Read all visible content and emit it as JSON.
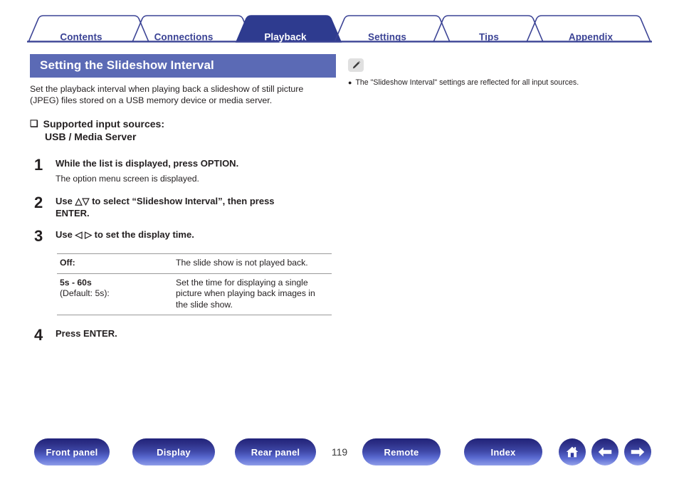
{
  "tabs": [
    {
      "label": "Contents",
      "active": false,
      "name": "tab-contents"
    },
    {
      "label": "Connections",
      "active": false,
      "name": "tab-connections"
    },
    {
      "label": "Playback",
      "active": true,
      "name": "tab-playback"
    },
    {
      "label": "Settings",
      "active": false,
      "name": "tab-settings"
    },
    {
      "label": "Tips",
      "active": false,
      "name": "tab-tips"
    },
    {
      "label": "Appendix",
      "active": false,
      "name": "tab-appendix"
    }
  ],
  "main": {
    "title": "Setting the Slideshow Interval",
    "intro": "Set the playback interval when playing back a slideshow of still picture (JPEG) files stored on a USB memory device or media server.",
    "sources_bullet": "❑",
    "sources_heading": "Supported input sources:",
    "sources_value": "USB / Media Server",
    "steps": [
      {
        "number": "1",
        "title": "While the list is displayed, press OPTION.",
        "sub": "The option menu screen is displayed."
      },
      {
        "number": "2",
        "title": "Use △▽ to select “Slideshow Interval”, then press ENTER.",
        "sub": ""
      },
      {
        "number": "3",
        "title": "Use ◁ ▷ to set the display time.",
        "sub": ""
      },
      {
        "number": "4",
        "title": "Press ENTER.",
        "sub": ""
      }
    ],
    "table": {
      "rows": [
        {
          "option": "Off:",
          "option_sub": "",
          "description": "The slide show is not played back."
        },
        {
          "option": "5s - 60s",
          "option_sub": "(Default: 5s):",
          "description": "Set the time for displaying a single picture when playing back images in the slide show."
        }
      ]
    }
  },
  "note": {
    "icon": "pencil-icon",
    "bullet": "●",
    "items": [
      "The \"Slideshow Interval\" settings are reflected for all input sources."
    ]
  },
  "bottom_nav": {
    "buttons": [
      {
        "label": "Front panel",
        "name": "front-panel-button"
      },
      {
        "label": "Display",
        "name": "display-button"
      },
      {
        "label": "Rear panel",
        "name": "rear-panel-button"
      },
      {
        "label": "Remote",
        "name": "remote-button"
      },
      {
        "label": "Index",
        "name": "index-button"
      }
    ],
    "page_number": "119",
    "icons": [
      {
        "name": "home-icon"
      },
      {
        "name": "back-arrow-icon"
      },
      {
        "name": "forward-arrow-icon"
      }
    ]
  },
  "colors": {
    "tab_navy": "#3b4395",
    "tab_active_fill": "#2e3b8f",
    "title_bar": "#5b6ab5",
    "button_blue": "#3f48a8",
    "text": "#231f20"
  }
}
